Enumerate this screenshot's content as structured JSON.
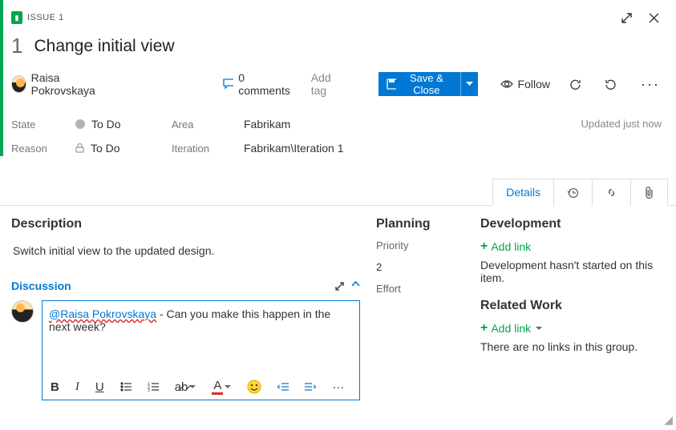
{
  "header": {
    "tag": "ISSUE 1",
    "id": "1",
    "title": "Change initial view"
  },
  "assignee": {
    "name": "Raisa Pokrovskaya"
  },
  "comments": {
    "count_label": "0 comments"
  },
  "add_tag": "Add tag",
  "save_label": "Save & Close",
  "follow_label": "Follow",
  "fields": {
    "state": {
      "label": "State",
      "value": "To Do"
    },
    "reason": {
      "label": "Reason",
      "value": "To Do"
    },
    "area": {
      "label": "Area",
      "value": "Fabrikam"
    },
    "iteration": {
      "label": "Iteration",
      "value": "Fabrikam\\Iteration 1"
    }
  },
  "updated": "Updated just now",
  "tabs": {
    "details": "Details"
  },
  "description": {
    "heading": "Description",
    "text": "Switch initial view to the updated design."
  },
  "discussion": {
    "heading": "Discussion",
    "mention": "@Raisa Pokrovskaya",
    "rest": " - Can you make this happen in the next week?"
  },
  "planning": {
    "heading": "Planning",
    "priority_label": "Priority",
    "priority": "2",
    "effort_label": "Effort"
  },
  "development": {
    "heading": "Development",
    "add_link": "Add link",
    "text": "Development hasn't started on this item."
  },
  "related": {
    "heading": "Related Work",
    "add_link": "Add link",
    "text": "There are no links in this group."
  }
}
